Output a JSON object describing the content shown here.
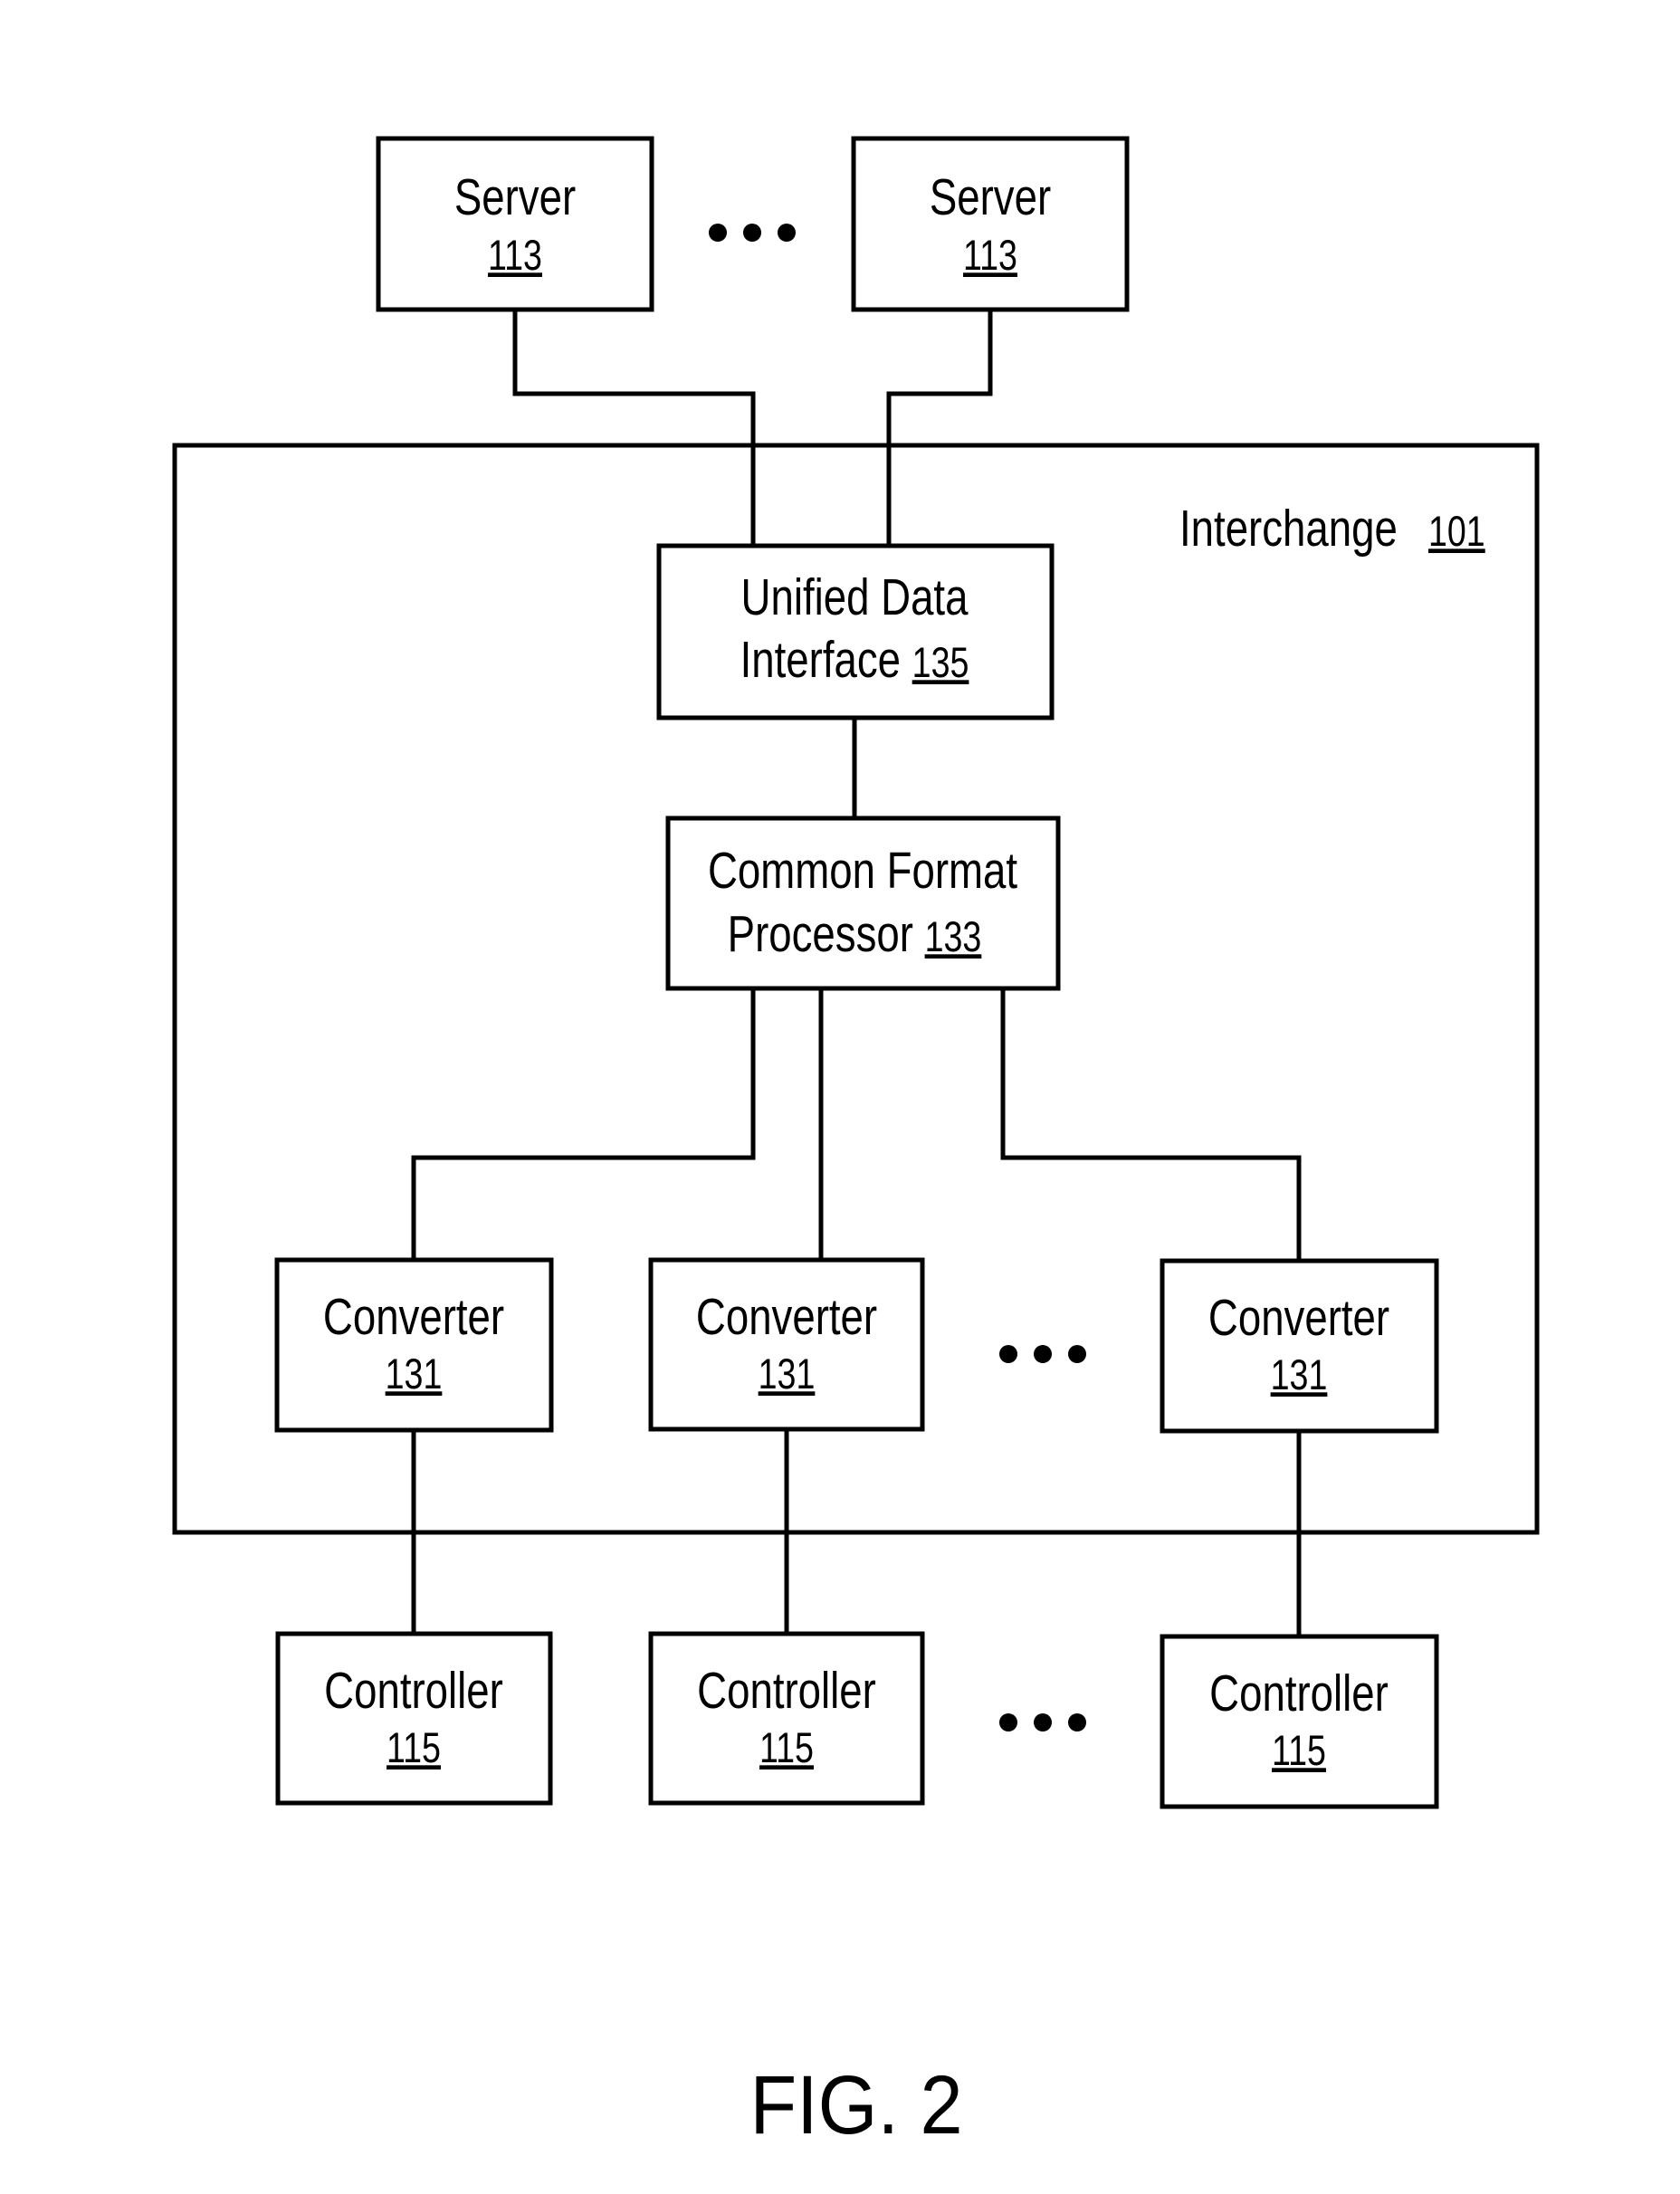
{
  "figure": {
    "caption": "FIG. 2",
    "colors": {
      "stroke": "#000000",
      "background": "#ffffff"
    }
  },
  "interchange": {
    "label": "Interchange",
    "ref": "101"
  },
  "servers": [
    {
      "label": "Server",
      "ref": "113"
    },
    {
      "label": "Server",
      "ref": "113"
    }
  ],
  "unified_data_interface": {
    "line1": "Unified Data",
    "line2": "Interface",
    "ref": "135"
  },
  "common_format_processor": {
    "line1": "Common Format",
    "line2": "Processor",
    "ref": "133"
  },
  "converters": [
    {
      "label": "Converter",
      "ref": "131"
    },
    {
      "label": "Converter",
      "ref": "131"
    },
    {
      "label": "Converter",
      "ref": "131"
    }
  ],
  "controllers": [
    {
      "label": "Controller",
      "ref": "115"
    },
    {
      "label": "Controller",
      "ref": "115"
    },
    {
      "label": "Controller",
      "ref": "115"
    }
  ],
  "ellipses": {
    "servers": "more servers",
    "converters": "more converters",
    "controllers": "more controllers"
  }
}
